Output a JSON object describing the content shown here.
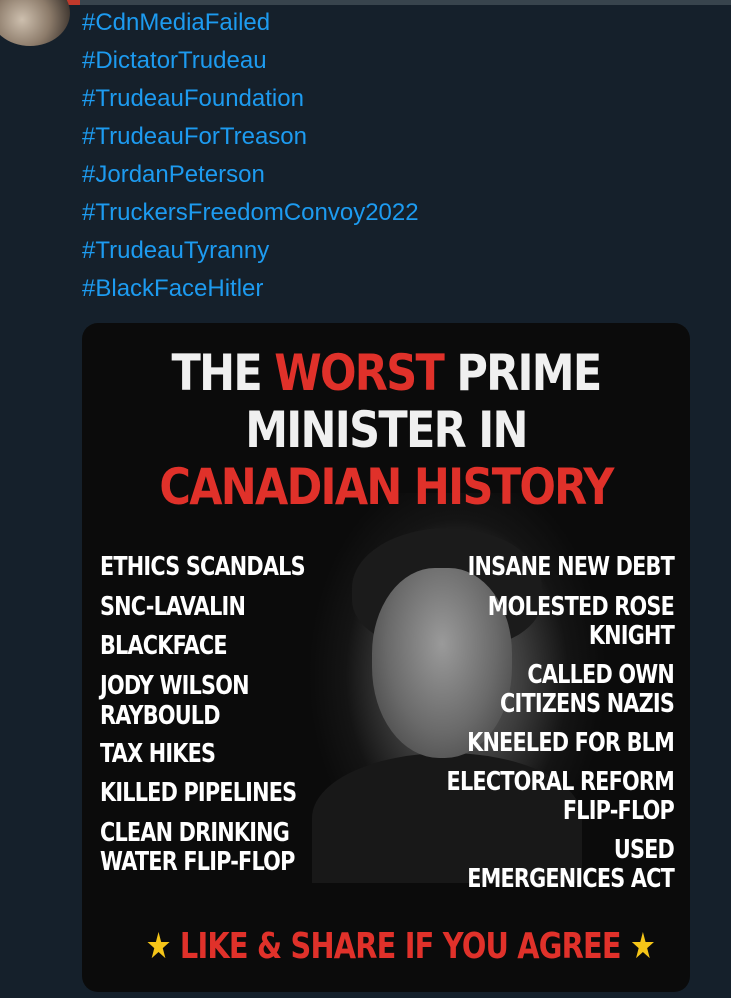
{
  "hashtags": [
    "#CdnMediaFailed",
    "#DictatorTrudeau",
    "#TrudeauFoundation",
    "#TrudeauForTreason",
    "#JordanPeterson",
    "#TruckersFreedomConvoy2022",
    "#TrudeauTyranny",
    "#BlackFaceHitler"
  ],
  "image": {
    "headline": {
      "part1": "THE",
      "part2_red": "WORST",
      "part3": "PRIME",
      "line2": "MINISTER IN",
      "line3_red": "CANADIAN HISTORY"
    },
    "left_list": [
      "ETHICS SCANDALS",
      "SNC-LAVALIN",
      "BLACKFACE",
      "JODY WILSON",
      "RAYBOULD",
      "TAX HIKES",
      "KILLED PIPELINES",
      "CLEAN DRINKING",
      "WATER FLIP-FLOP"
    ],
    "right_list": [
      "INSANE NEW DEBT",
      "MOLESTED ROSE",
      "KNIGHT",
      "CALLED OWN",
      "CITIZENS NAZIS",
      "KNEELED FOR BLM",
      "ELECTORAL REFORM",
      "FLIP-FLOP",
      "USED",
      "EMERGENICES ACT"
    ],
    "footer": {
      "star_left": "★",
      "cta": "LIKE & SHARE IF YOU AGREE",
      "star_right": "★"
    }
  },
  "colors": {
    "background": "#15202b",
    "link": "#1d9bf0",
    "accent_red": "#e0312a",
    "star": "#f5c518"
  }
}
